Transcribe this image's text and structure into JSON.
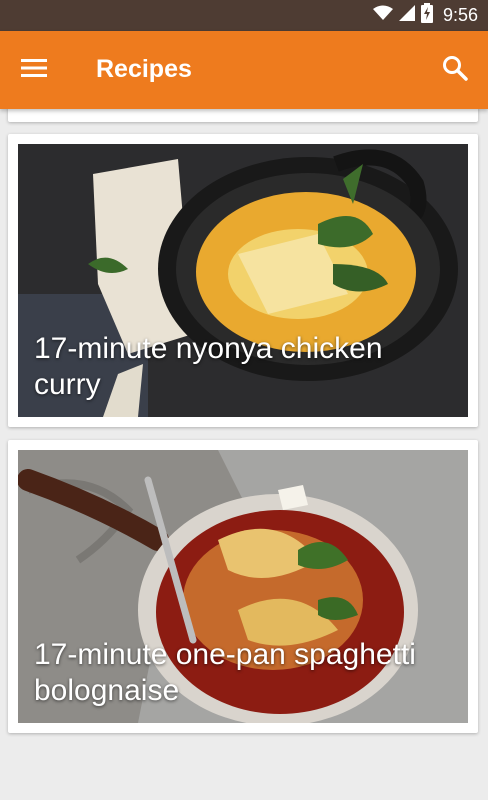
{
  "status_bar": {
    "time": "9:56",
    "icons": [
      "wifi-icon",
      "cell-signal-icon",
      "battery-charging-icon"
    ]
  },
  "app_bar": {
    "title": "Recipes",
    "icons": [
      "menu-icon",
      "search-icon"
    ],
    "color": "#ee7b1e"
  },
  "recipes": [
    {
      "title": "17-minute nyonya chicken curry"
    },
    {
      "title": "17-minute one-pan spaghetti bolognaise"
    }
  ]
}
